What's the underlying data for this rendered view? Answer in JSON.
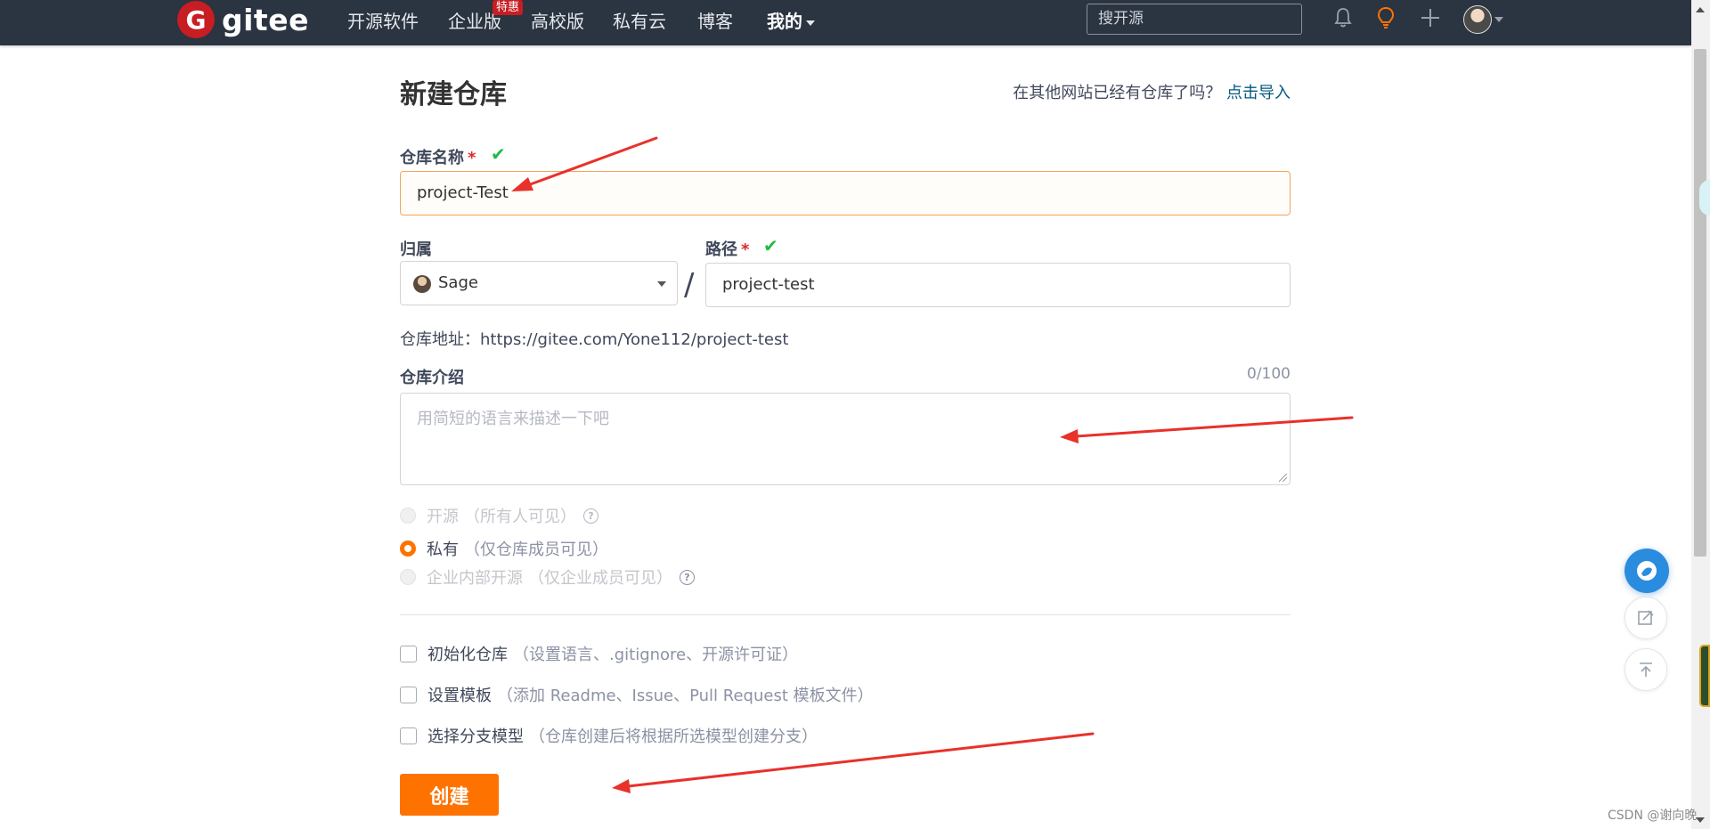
{
  "nav": {
    "logo_mark": "G",
    "logo_text": "gitee",
    "items": [
      "开源软件",
      "企业版",
      "高校版",
      "私有云",
      "博客"
    ],
    "mine_label": "我的",
    "enterprise_badge": "特惠",
    "search_placeholder": "搜开源",
    "icons": [
      "bell-icon",
      "lightbulb-icon",
      "plus-icon",
      "avatar"
    ]
  },
  "page": {
    "title": "新建仓库",
    "import_prompt": "在其他网站已经有仓库了吗？",
    "import_link": "点击导入"
  },
  "form": {
    "repo_name_label": "仓库名称",
    "repo_name_value": "project-Test",
    "required_mark": "*",
    "owner_label": "归属",
    "owner_value": "Sage",
    "path_label": "路径",
    "path_separator": "/",
    "path_value": "project-test",
    "repo_url": "仓库地址：https://gitee.com/Yone112/project-test",
    "intro_label": "仓库介绍",
    "intro_counter": "0/100",
    "intro_placeholder": "用简短的语言来描述一下吧",
    "visibility": [
      {
        "label": "开源",
        "hint": "（所有人可见）",
        "state": "disabled",
        "help": true
      },
      {
        "label": "私有",
        "hint": "（仅仓库成员可见）",
        "state": "checked",
        "help": false
      },
      {
        "label": "企业内部开源",
        "hint": "（仅企业成员可见）",
        "state": "disabled",
        "help": true
      }
    ],
    "options": [
      {
        "label": "初始化仓库",
        "hint": "（设置语言、.gitignore、开源许可证）"
      },
      {
        "label": "设置模板",
        "hint": "（添加 Readme、Issue、Pull Request 模板文件）"
      },
      {
        "label": "选择分支模型",
        "hint": "（仓库创建后将根据所选模型创建分支）"
      }
    ],
    "create_button": "创建"
  },
  "colors": {
    "nav_bg": "#2b3441",
    "brand_red": "#c71d23",
    "accent_orange": "#fe7300",
    "link": "#005980",
    "success_green": "#21ba45",
    "annotation_red": "#e8312a"
  },
  "watermark": "CSDN @谢向晚"
}
